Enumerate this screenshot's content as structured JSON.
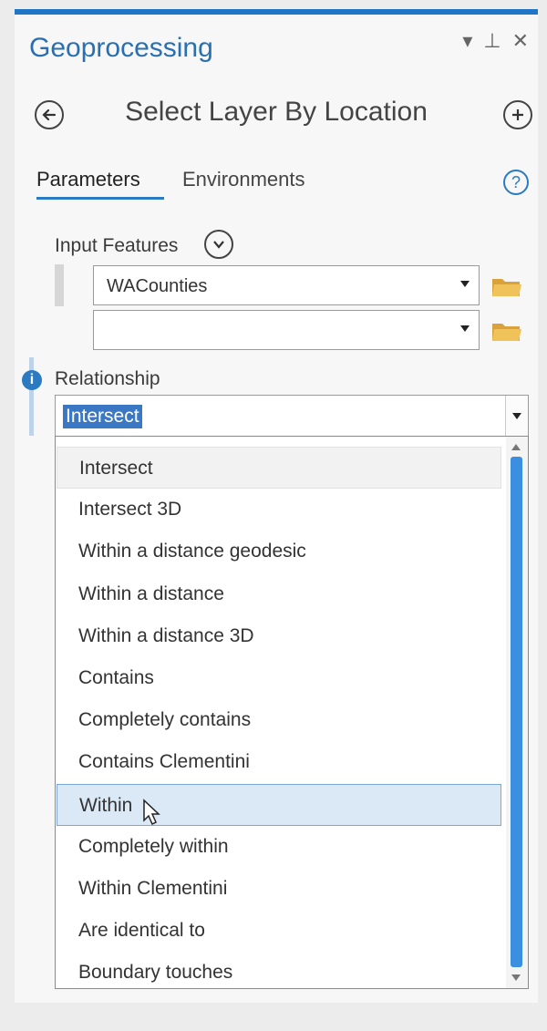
{
  "panel": {
    "title": "Geoprocessing",
    "window_controls": {
      "menu": "▾",
      "pin": "⊥",
      "close": "✕"
    },
    "tool_name": "Select Layer By Location",
    "tabs": [
      {
        "label": "Parameters",
        "active": true
      },
      {
        "label": "Environments",
        "active": false
      }
    ],
    "help_icon": "?"
  },
  "input_features": {
    "label": "Input Features",
    "rows": [
      {
        "value": "WACounties"
      },
      {
        "value": ""
      }
    ]
  },
  "relationship": {
    "label": "Relationship",
    "selected": "Intersect",
    "options": [
      "Intersect",
      "Intersect 3D",
      "Within a distance geodesic",
      "Within a distance",
      "Within a distance 3D",
      "Contains",
      "Completely contains",
      "Contains Clementini",
      "Within",
      "Completely within",
      "Within Clementini",
      "Are identical to",
      "Boundary touches"
    ],
    "hovered_option": "Within"
  },
  "colors": {
    "accent": "#2a7bc1",
    "title": "#2a6fb0",
    "selection": "#3a78c4",
    "hover": "#dbe9f6",
    "folder": "#e8b84a"
  }
}
